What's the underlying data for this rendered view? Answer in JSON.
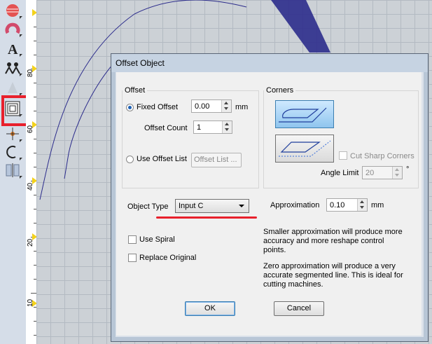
{
  "ruler": {
    "labels": [
      "80",
      "60",
      "40",
      "20",
      "10"
    ]
  },
  "dialog": {
    "title": "Offset Object",
    "offset_group": {
      "legend": "Offset",
      "fixed_offset_label": "Fixed Offset",
      "fixed_offset_value": "0.00",
      "fixed_offset_unit": "mm",
      "offset_count_label": "Offset Count",
      "offset_count_value": "1",
      "use_offset_list_label": "Use Offset List",
      "offset_list_button": "Offset List ..."
    },
    "corners_group": {
      "legend": "Corners",
      "cut_sharp_corners_label": "Cut Sharp Corners",
      "angle_limit_label": "Angle Limit",
      "angle_limit_value": "20",
      "angle_unit": "°"
    },
    "object_type_label": "Object Type",
    "object_type_value": "Input C",
    "approximation_label": "Approximation",
    "approximation_value": "0.10",
    "approximation_unit": "mm",
    "use_spiral_label": "Use Spiral",
    "replace_original_label": "Replace Original",
    "info_1": "Smaller approximation will produce more accuracy and more reshape control points.",
    "info_2": "Zero approximation will produce a very accurate segmented line. This is ideal for cutting machines.",
    "ok_label": "OK",
    "cancel_label": "Cancel"
  },
  "colors": {
    "highlight": "#e8202c",
    "select_blue": "#1b5fb5",
    "stitch": "#2c2c8c"
  }
}
